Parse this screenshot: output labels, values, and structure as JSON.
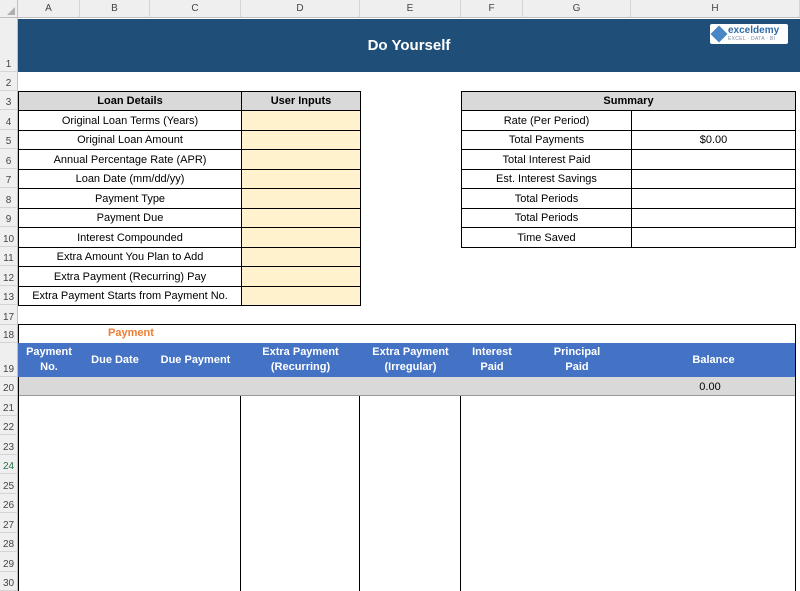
{
  "columns": [
    "A",
    "B",
    "C",
    "D",
    "E",
    "F",
    "G",
    "H"
  ],
  "rows": [
    "1",
    "2",
    "3",
    "4",
    "5",
    "6",
    "7",
    "8",
    "9",
    "10",
    "11",
    "12",
    "13",
    "17",
    "18",
    "19",
    "20",
    "21",
    "22",
    "23",
    "24",
    "25",
    "26",
    "27",
    "28",
    "29",
    "30"
  ],
  "title": "Do Yourself",
  "logo": {
    "name": "exceldemy",
    "tagline": "EXCEL · DATA · BI"
  },
  "loan_details": {
    "header": "Loan Details",
    "inputs_header": "User Inputs",
    "labels": [
      "Original Loan Terms (Years)",
      "Original Loan Amount",
      "Annual Percentage Rate (APR)",
      "Loan Date (mm/dd/yy)",
      "Payment Type",
      "Payment Due",
      "Interest Compounded",
      "Extra Amount You Plan to Add",
      "Extra Payment (Recurring) Pay",
      "Extra Payment Starts from Payment No."
    ]
  },
  "summary": {
    "header": "Summary",
    "labels": [
      "Rate (Per Period)",
      "Total Payments",
      "Total Interest Paid",
      "Est. Interest Savings",
      "Total Periods",
      "Total Periods",
      "Time Saved"
    ],
    "values": [
      "",
      "$0.00",
      "",
      "",
      "",
      "",
      ""
    ]
  },
  "payment": {
    "section_label": "Payment",
    "section_color": "#ed7d31",
    "header_color": "#4472c4",
    "headers": [
      "Payment\nNo.",
      "Due Date",
      "Due Payment",
      "Extra Payment\n(Recurring)",
      "Extra Payment\n(Irregular)",
      "Interest\nPaid",
      "Principal\nPaid",
      "Balance"
    ],
    "first_row_balance": "0.00"
  },
  "colors": {
    "title_band": "#1f4e78",
    "input_fill": "#fff2cc",
    "header_gray": "#d9d9d9"
  }
}
